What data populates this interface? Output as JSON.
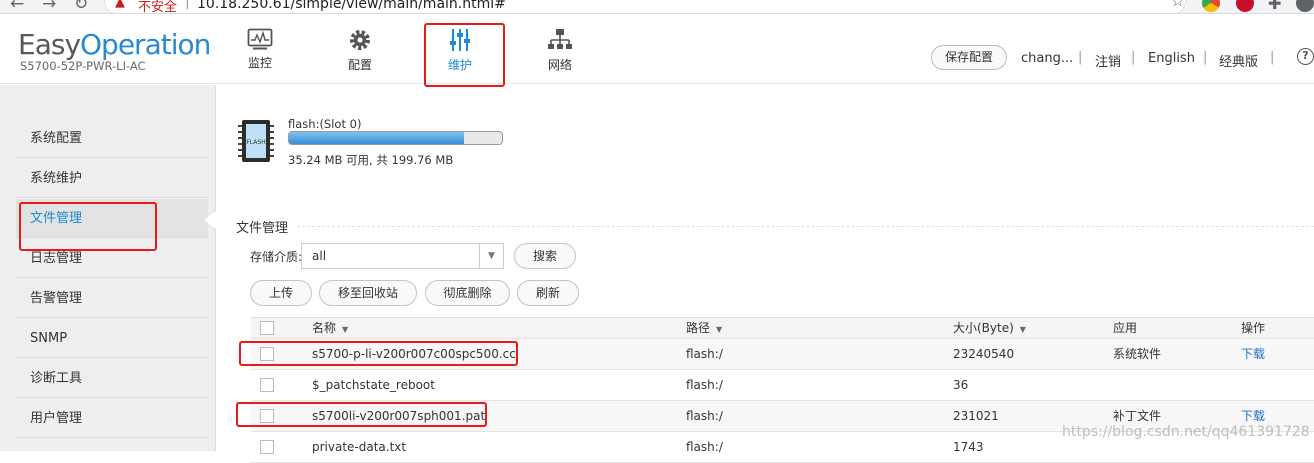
{
  "browser": {
    "security_label": "不安全",
    "url": "10.18.250.61/simple/view/main/main.html#"
  },
  "header": {
    "logo_easy": "Easy",
    "logo_operation": "Operation",
    "device_model": "S5700-52P-PWR-LI-AC",
    "nav": [
      {
        "label": "监控",
        "icon": "monitor-icon"
      },
      {
        "label": "配置",
        "icon": "gear-icon"
      },
      {
        "label": "维护",
        "icon": "sliders-icon",
        "active": true
      },
      {
        "label": "网络",
        "icon": "network-icon"
      }
    ],
    "save_config": "保存配置",
    "user": "chang...",
    "logout": "注销",
    "language": "English",
    "classic": "经典版",
    "separator": "|",
    "help": "?"
  },
  "sidebar": {
    "items": [
      "系统配置",
      "系统维护",
      "文件管理",
      "日志管理",
      "告警管理",
      "SNMP",
      "诊断工具",
      "用户管理"
    ],
    "active_index": 2
  },
  "storage": {
    "icon_label": "FLASH",
    "title": "flash:(Slot 0)",
    "used_fraction": 0.8236,
    "usage": "35.24 MB 可用, 共 199.76 MB"
  },
  "files": {
    "section_title": "文件管理",
    "media_label": "存储介质:",
    "media_value": "all",
    "search": "搜索",
    "upload": "上传",
    "move_to_recycle": "移至回收站",
    "delete": "彻底删除",
    "refresh": "刷新",
    "columns": {
      "name": "名称",
      "path": "路径",
      "size": "大小(Byte)",
      "app": "应用",
      "action": "操作"
    },
    "rows": [
      {
        "name": "s5700-p-li-v200r007c00spc500.cc",
        "path": "flash:/",
        "size": "23240540",
        "app": "系统软件",
        "action": "下载"
      },
      {
        "name": "$_patchstate_reboot",
        "path": "flash:/",
        "size": "36",
        "app": "",
        "action": ""
      },
      {
        "name": "s5700li-v200r007sph001.pat",
        "path": "flash:/",
        "size": "231021",
        "app": "补丁文件",
        "action": "下载"
      },
      {
        "name": "private-data.txt",
        "path": "flash:/",
        "size": "1743",
        "app": "",
        "action": ""
      }
    ]
  },
  "watermark": "https://blog.csdn.net/qq461391728"
}
